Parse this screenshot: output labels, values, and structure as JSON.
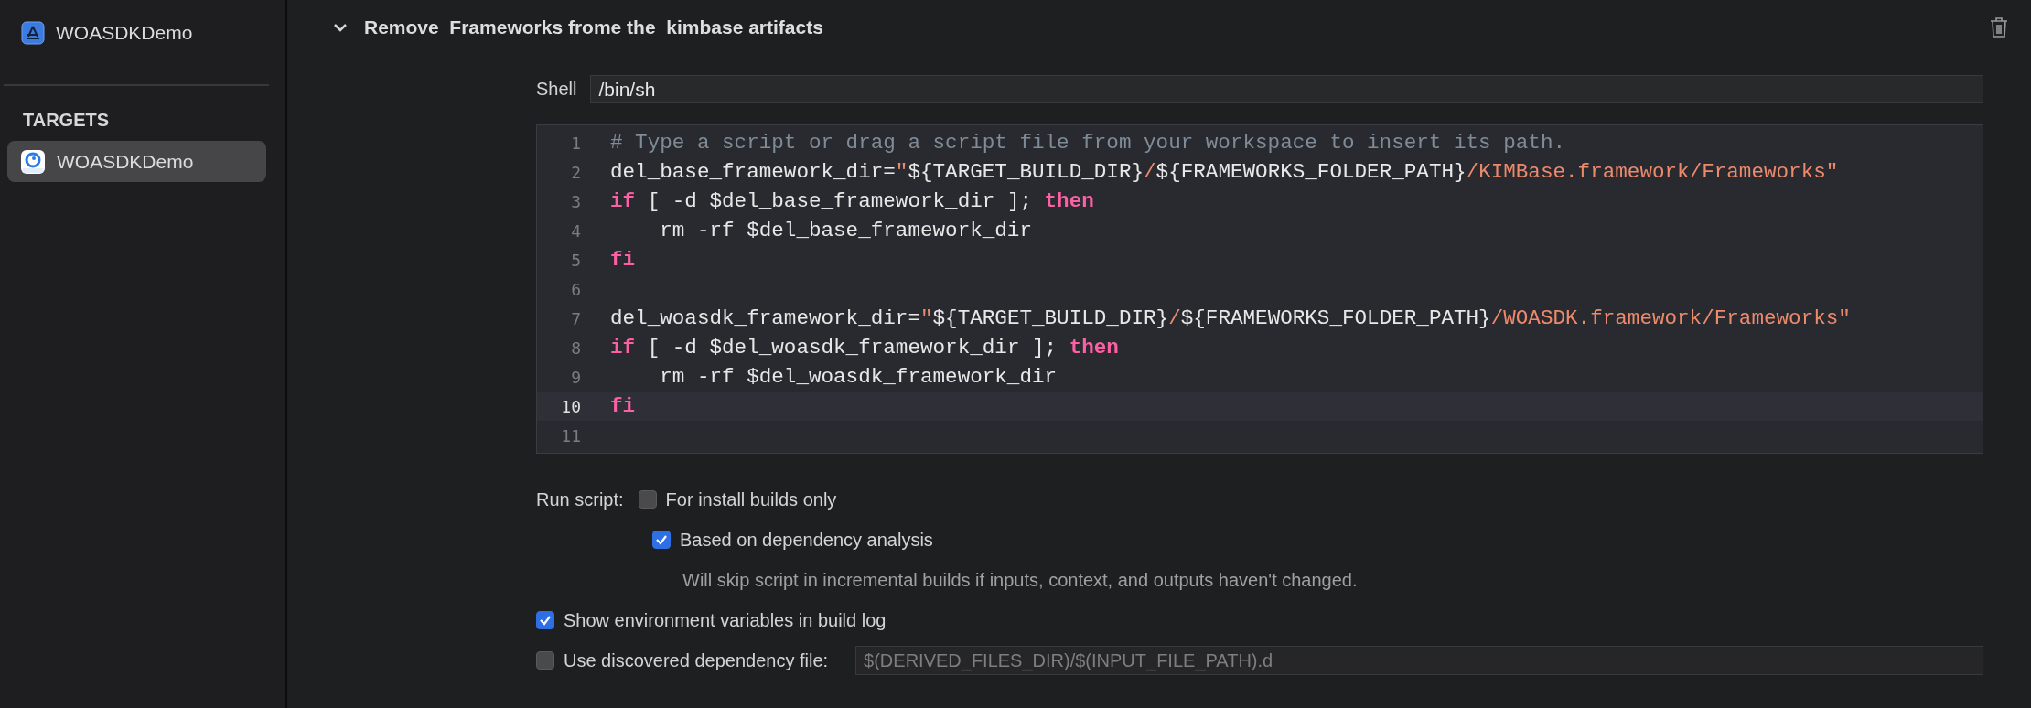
{
  "sidebar": {
    "project": {
      "label": "WOASDKDemo"
    },
    "section_title": "TARGETS",
    "targets": [
      {
        "label": "WOASDKDemo",
        "selected": true
      }
    ]
  },
  "phase": {
    "title": "Remove  Frameworks frome the  kimbase artifacts",
    "expanded": true,
    "shell": {
      "label": "Shell",
      "value": "/bin/sh"
    },
    "code_lines": [
      {
        "number": "1",
        "current": false,
        "tokens": [
          {
            "kind": "comment",
            "text": "# Type a script or drag a script file from your workspace to insert its path."
          }
        ]
      },
      {
        "number": "2",
        "current": false,
        "tokens": [
          {
            "kind": "plain",
            "text": "del_base_framework_dir="
          },
          {
            "kind": "string",
            "text": "\""
          },
          {
            "kind": "plain",
            "text": "${TARGET_BUILD_DIR}"
          },
          {
            "kind": "string",
            "text": "/"
          },
          {
            "kind": "plain",
            "text": "${FRAMEWORKS_FOLDER_PATH}"
          },
          {
            "kind": "string",
            "text": "/KIMBase.framework/Frameworks\""
          }
        ]
      },
      {
        "number": "3",
        "current": false,
        "tokens": [
          {
            "kind": "keyword",
            "text": "if"
          },
          {
            "kind": "plain",
            "text": " [ -d $del_base_framework_dir ]; "
          },
          {
            "kind": "keyword",
            "text": "then"
          }
        ]
      },
      {
        "number": "4",
        "current": false,
        "tokens": [
          {
            "kind": "plain",
            "text": "    rm -rf $del_base_framework_dir"
          }
        ]
      },
      {
        "number": "5",
        "current": false,
        "tokens": [
          {
            "kind": "keyword",
            "text": "fi"
          }
        ]
      },
      {
        "number": "6",
        "current": false
      },
      {
        "number": "7",
        "current": false,
        "tokens": [
          {
            "kind": "plain",
            "text": "del_woasdk_framework_dir="
          },
          {
            "kind": "string",
            "text": "\""
          },
          {
            "kind": "plain",
            "text": "${TARGET_BUILD_DIR}"
          },
          {
            "kind": "string",
            "text": "/"
          },
          {
            "kind": "plain",
            "text": "${FRAMEWORKS_FOLDER_PATH}"
          },
          {
            "kind": "string",
            "text": "/WOASDK.framework/Frameworks\""
          }
        ]
      },
      {
        "number": "8",
        "current": false,
        "tokens": [
          {
            "kind": "keyword",
            "text": "if"
          },
          {
            "kind": "plain",
            "text": " [ -d $del_woasdk_framework_dir ]; "
          },
          {
            "kind": "keyword",
            "text": "then"
          }
        ]
      },
      {
        "number": "9",
        "current": false,
        "tokens": [
          {
            "kind": "plain",
            "text": "    rm -rf $del_woasdk_framework_dir"
          }
        ]
      },
      {
        "number": "10",
        "current": true,
        "tokens": [
          {
            "kind": "keyword",
            "text": "fi"
          }
        ]
      },
      {
        "number": "11",
        "current": false
      }
    ],
    "run_script_label": "Run script:",
    "options": [
      {
        "kind": "sub",
        "label": "For install builds only",
        "checked": false
      },
      {
        "kind": "sub",
        "label": "Based on dependency analysis",
        "checked": true
      },
      {
        "kind": "note",
        "text": "Will skip script in incremental builds if inputs, context, and outputs haven't changed."
      },
      {
        "kind": "main",
        "label": "Show environment variables in build log",
        "checked": true
      },
      {
        "kind": "field",
        "label": "Use discovered dependency file:",
        "checked": false,
        "placeholder": "$(DERIVED_FILES_DIR)/$(INPUT_FILE_PATH).d"
      }
    ]
  }
}
